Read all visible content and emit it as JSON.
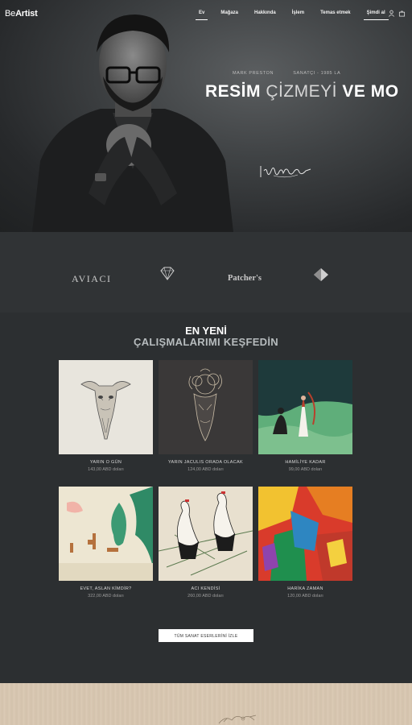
{
  "brand": {
    "part1": "Be",
    "part2": "Artist"
  },
  "nav": {
    "items": [
      {
        "label": "Ev"
      },
      {
        "label": "Mağaza"
      },
      {
        "label": "Hakkında"
      },
      {
        "label": "İşlem"
      },
      {
        "label": "Temas etmek"
      },
      {
        "label": "Şimdi al"
      }
    ],
    "icons": [
      "user-icon",
      "cart-icon"
    ]
  },
  "hero": {
    "artist_name": "MARK PRESTON",
    "artist_role": "SANATÇI - 1985 LA",
    "title_bold": "RESİM ",
    "title_light": "ÇİZMEYİ ",
    "title_rest": "VE MO"
  },
  "partners": {
    "logo1": "AVIACI",
    "logo3": "Patcher's"
  },
  "section": {
    "title_line1": "EN YENİ",
    "title_line2": "ÇALIŞMALARIMI KEŞFEDİN"
  },
  "artworks": [
    {
      "title": "YARIN O GÜN",
      "price": "143,00 ABD doları"
    },
    {
      "title": "YARIN JACULIS ORADA OLACAK",
      "price": "124,00 ABD doları"
    },
    {
      "title": "HAMİLİYE KADAR",
      "price": "99,00 ABD doları"
    },
    {
      "title": "EVET, ASLAN KİMDİR?",
      "price": "322,00 ABD doları"
    },
    {
      "title": "ACI KENDİSİ",
      "price": "260,00 ABD doları"
    },
    {
      "title": "HARİKA ZAMAN",
      "price": "120,00 ABD doları"
    }
  ],
  "cta": {
    "view_all": "TÜM SANAT ESERLERİNİ İZLE"
  },
  "colors": {
    "background": "#2c2f31",
    "accent": "#ffffff"
  }
}
